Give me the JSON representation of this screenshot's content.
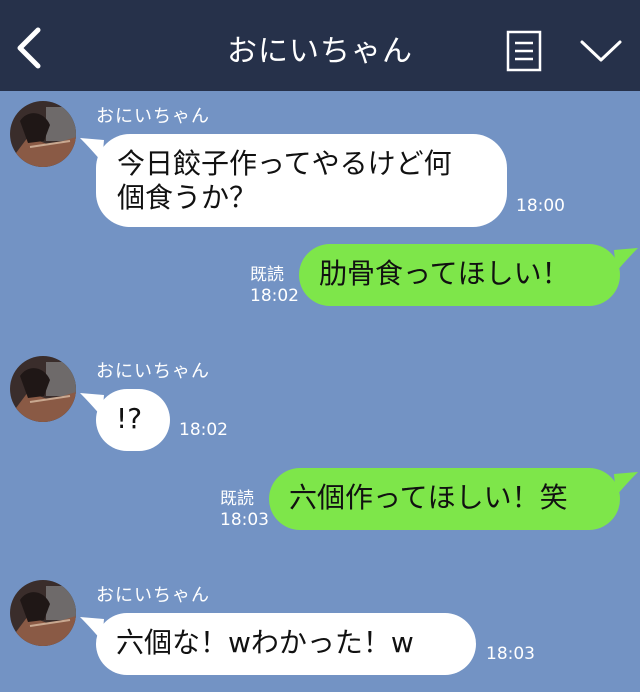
{
  "header": {
    "title": "おにいちゃん",
    "back_icon": "chevron-left-icon",
    "notes_icon": "notes-menu-icon",
    "expand_icon": "chevron-down-icon",
    "background": "#26314a"
  },
  "chat": {
    "background": "#7393c4",
    "incoming_color": "#ffffff",
    "outgoing_color": "#7ee64a",
    "messages": [
      {
        "direction": "in",
        "sender": "おにいちゃん",
        "text": "今日餃子作ってやるけど何\n個食うか？",
        "time": "18:00"
      },
      {
        "direction": "out",
        "read": "既読",
        "text": "肋骨食ってほしい！",
        "time": "18:02"
      },
      {
        "direction": "in",
        "sender": "おにいちゃん",
        "text": "!?",
        "time": "18:02"
      },
      {
        "direction": "out",
        "read": "既読",
        "text": "六個作ってほしい！笑",
        "time": "18:03"
      },
      {
        "direction": "in",
        "sender": "おにいちゃん",
        "text": "六個な！wわかった！w",
        "time": "18:03"
      }
    ]
  }
}
